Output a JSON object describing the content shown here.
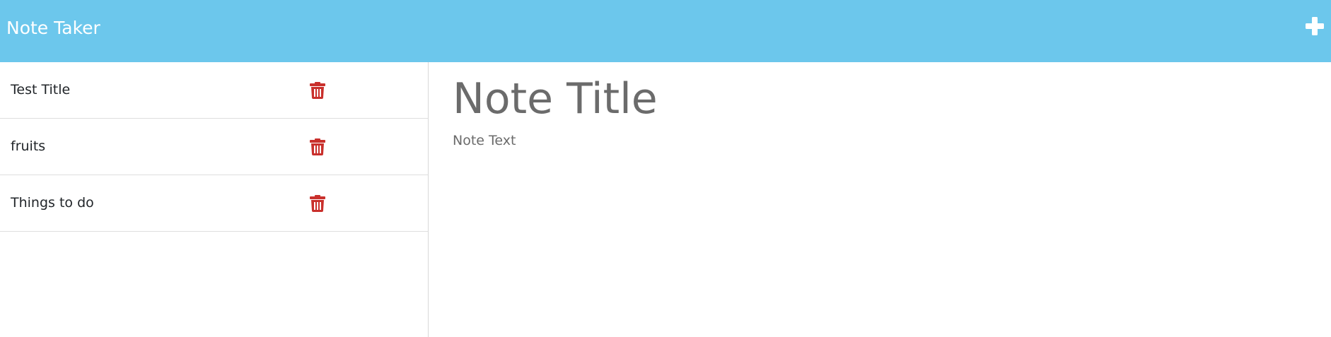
{
  "app": {
    "title": "Note Taker",
    "header_color": "#6cc7ec",
    "new_note_icon": "plus-icon"
  },
  "sidebar": {
    "notes": [
      {
        "title": "Test Title",
        "delete_icon": "trash-icon"
      },
      {
        "title": "fruits",
        "delete_icon": "trash-icon"
      },
      {
        "title": "Things to do",
        "delete_icon": "trash-icon"
      }
    ],
    "delete_icon_color": "#c9302c"
  },
  "editor": {
    "title_placeholder": "Note Title",
    "text_placeholder": "Note Text"
  }
}
